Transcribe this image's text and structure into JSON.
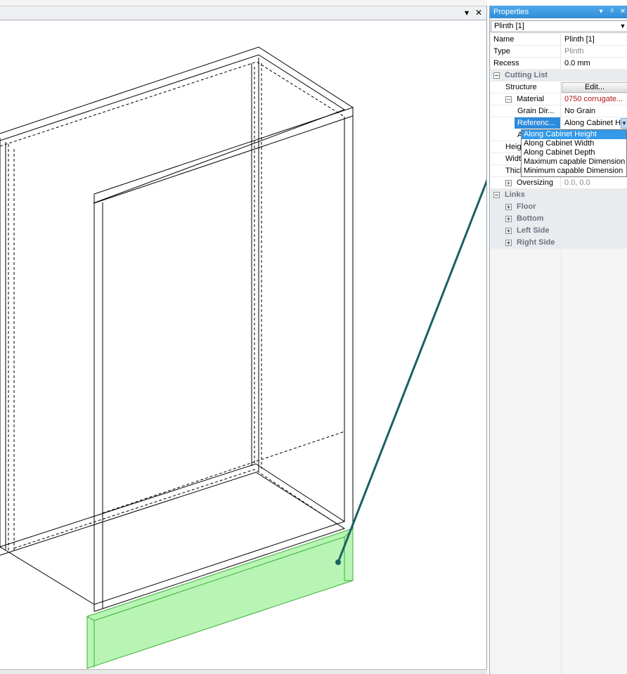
{
  "viewport": {
    "menu_glyph": "▾",
    "close_glyph": "✕"
  },
  "panel": {
    "title": "Properties",
    "menu_glyph": "▾",
    "pin_glyph": "ᵖ",
    "close_glyph": "✕",
    "selected_object": "Plinth [1]",
    "rows": {
      "name": {
        "label": "Name",
        "value": "Plinth [1]"
      },
      "type": {
        "label": "Type",
        "value": "Plinth"
      },
      "recess": {
        "label": "Recess",
        "value": "0.0 mm"
      },
      "cutting_list": {
        "label": "Cutting List"
      },
      "structure": {
        "label": "Structure",
        "button": "Edit..."
      },
      "material": {
        "label": "Material",
        "value": "0750 corrugate..."
      },
      "grain_direction": {
        "label": "Grain Dir...",
        "value": "No Grain"
      },
      "reference": {
        "label": "Referenc...",
        "value": "Along Cabinet H"
      },
      "a_row": {
        "label": "A"
      },
      "height": {
        "label": "Heig"
      },
      "width": {
        "label": "Widt"
      },
      "thickness": {
        "label": "Thick"
      },
      "oversizing": {
        "label": "Oversizing",
        "value": "0.0, 0.0"
      },
      "links": {
        "label": "Links"
      },
      "floor": {
        "label": "Floor"
      },
      "bottom": {
        "label": "Bottom"
      },
      "left_side": {
        "label": "Left Side"
      },
      "right_side": {
        "label": "Right Side"
      }
    },
    "dropdown_options": [
      "Along Cabinet Height",
      "Along Cabinet Width",
      "Along Cabinet Depth",
      "Maximum capable Dimension",
      "Minimum capable Dimension"
    ],
    "dropdown_selected": "Along Cabinet Height"
  },
  "colors": {
    "title_bar": "#2f8ed8",
    "selection": "#2e8bdc",
    "plinth_fill": "#b8f5b4",
    "arrow": "#1d5f66",
    "material_text": "#b01818"
  }
}
